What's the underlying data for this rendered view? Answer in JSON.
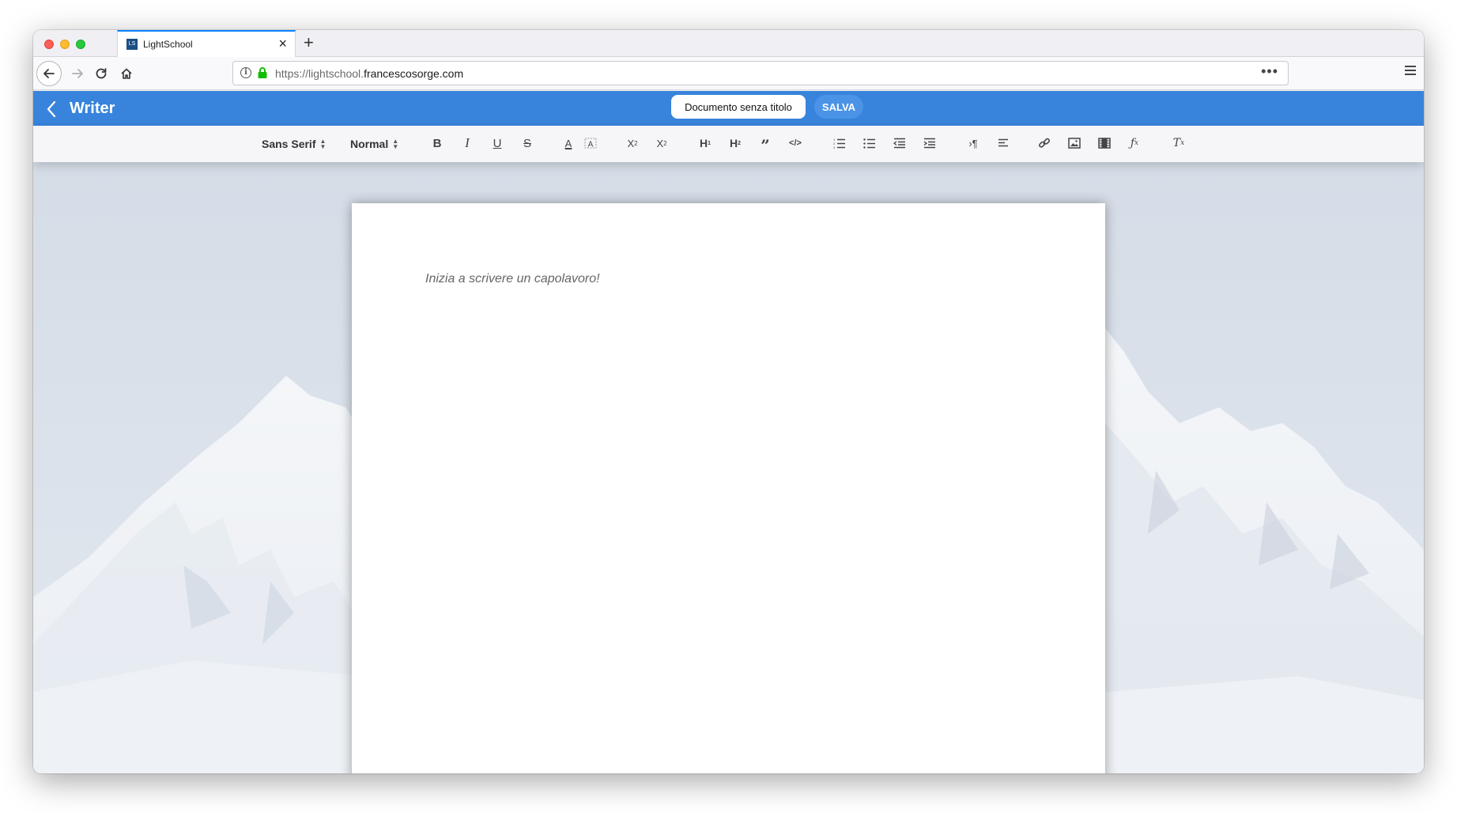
{
  "browser": {
    "tab_title": "LightSchool",
    "tab_favicon_text": "LS",
    "url_prefix": "https://lightschool.",
    "url_domain": "francescosorge.com",
    "url_more": "•••"
  },
  "app": {
    "title": "Writer",
    "document_title": "Documento senza titolo",
    "save_label": "SALVA",
    "accent_color": "#3884dc"
  },
  "toolbar": {
    "font_select": "Sans Serif",
    "size_select": "Normal",
    "buttons": [
      "bold",
      "italic",
      "underline",
      "strike",
      "text-color",
      "background-color",
      "subscript",
      "superscript",
      "heading-1",
      "heading-2",
      "blockquote",
      "code-block",
      "ordered-list",
      "bullet-list",
      "outdent",
      "indent",
      "text-direction",
      "align",
      "link",
      "image",
      "video",
      "formula",
      "clear-formatting"
    ]
  },
  "editor": {
    "placeholder": "Inizia a scrivere un capolavoro!"
  }
}
